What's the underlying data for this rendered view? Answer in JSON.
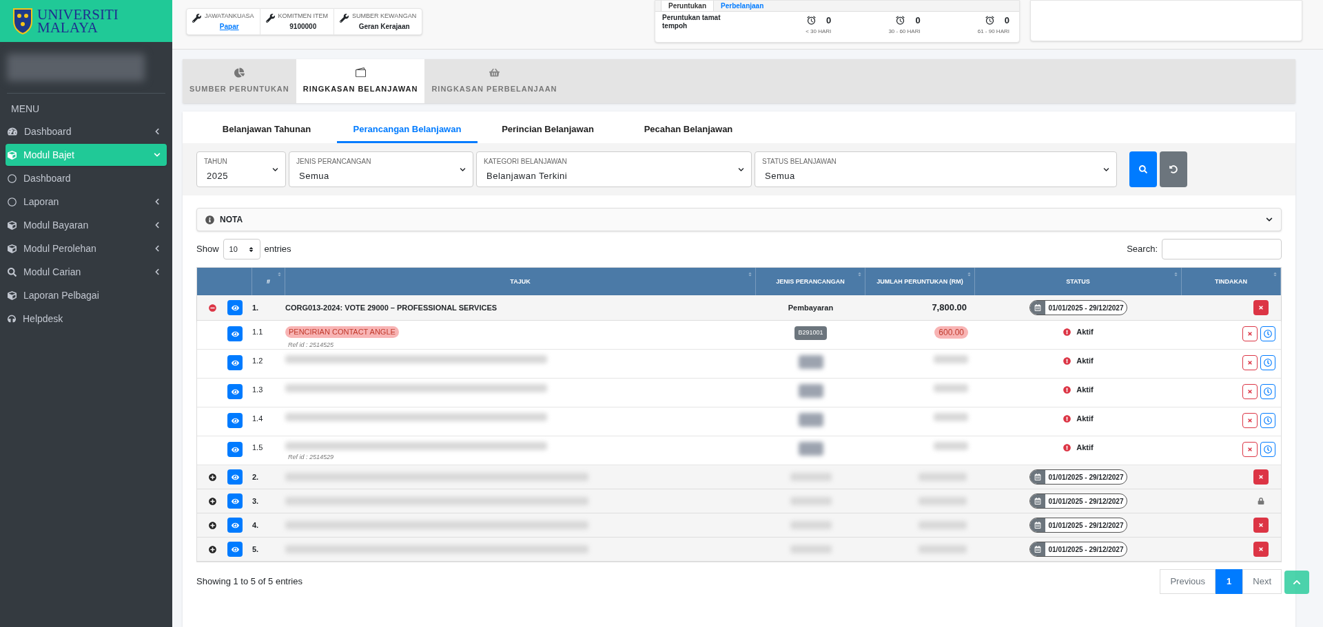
{
  "brand": {
    "line_1": "UNIVERSITI",
    "line_2": "MALAYA"
  },
  "sidebar": {
    "heading": "MENU",
    "items": [
      {
        "label": "Dashboard",
        "kind": "gauge",
        "selected": false,
        "submenu": true,
        "expanded": false
      },
      {
        "label": "Modul Bajet",
        "kind": "cube",
        "selected": true,
        "submenu": true,
        "expanded": true
      },
      {
        "label": "Dashboard",
        "kind": "circle",
        "selected": false,
        "submenu": false
      },
      {
        "label": "Laporan",
        "kind": "circle",
        "selected": false,
        "submenu": true,
        "expanded": false
      },
      {
        "label": "Modul Bayaran",
        "kind": "cube",
        "selected": false,
        "submenu": true,
        "expanded": false
      },
      {
        "label": "Modul Perolehan",
        "kind": "cube",
        "selected": false,
        "submenu": true,
        "expanded": false
      },
      {
        "label": "Modul Carian",
        "kind": "search",
        "selected": false,
        "submenu": true,
        "expanded": false
      },
      {
        "label": "Laporan Pelbagai",
        "kind": "cube",
        "selected": false,
        "submenu": false
      },
      {
        "label": "Helpdesk",
        "kind": "headset",
        "selected": false,
        "submenu": false
      }
    ]
  },
  "info_card": [
    {
      "label": "JAWATANKUASA",
      "value": "Papar",
      "kind": "link"
    },
    {
      "label": "KOMITMEN ITEM",
      "value": "9100000",
      "kind": "text"
    },
    {
      "label": "SUMBER KEWANGAN",
      "value": "Geran Kerajaan",
      "kind": "text"
    }
  ],
  "expiry_card": {
    "tabs": [
      {
        "label": "Peruntukan",
        "selected": true
      },
      {
        "label": "Perbelanjaan",
        "selected": false
      }
    ],
    "label": "Peruntukan tamat tempoh",
    "counters": [
      {
        "value": "0",
        "label": "< 30 HARI"
      },
      {
        "value": "0",
        "label": "30 - 60 HARI"
      },
      {
        "value": "0",
        "label": "61 - 90 HARI"
      }
    ]
  },
  "main_tabs": [
    {
      "label": "SUMBER PERUNTUKAN",
      "kind": "pie",
      "selected": false
    },
    {
      "label": "RINGKASAN BELANJAWAN",
      "kind": "wallet",
      "selected": true
    },
    {
      "label": "RINGKASAN PERBELANJAAN",
      "kind": "basket",
      "selected": false
    }
  ],
  "sub_tabs": [
    {
      "label": "Belanjawan Tahunan",
      "selected": false
    },
    {
      "label": "Perancangan Belanjawan",
      "selected": true
    },
    {
      "label": "Perincian Belanjawan",
      "selected": false
    },
    {
      "label": "Pecahan Belanjawan",
      "selected": false
    }
  ],
  "filters": [
    {
      "label": "TAHUN",
      "value": "2025"
    },
    {
      "label": "JENIS PERANCANGAN",
      "value": "Semua"
    },
    {
      "label": "KATEGORI BELANJAWAN",
      "value": "Belanjawan Terkini"
    },
    {
      "label": "STATUS BELANJAWAN",
      "value": "Semua"
    }
  ],
  "nota": {
    "label": "NOTA",
    "expanded": false
  },
  "length_control": {
    "before": "Show",
    "value": "10",
    "after": "entries"
  },
  "search": {
    "label": "Search:"
  },
  "table": {
    "columns": [
      "#",
      "TAJUK",
      "JENIS PERANCANGAN",
      "JUMLAH PERUNTUKAN (RM)",
      "STATUS",
      "TINDAKAN"
    ],
    "rows": [
      {
        "number": "1.",
        "title": "CORG013-2024: VOTE 29000 – PROFESSIONAL SERVICES",
        "jenis": "Pembayaran",
        "amount": "7,800.00",
        "period": "01/01/2025 - 29/12/2027",
        "kind": "delete",
        "expanded": true,
        "children": [
          {
            "number": "1.1",
            "title": "PENCIRIAN CONTACT ANGLE",
            "ref": "Ref id : 2514525",
            "code": "B291001",
            "amount": "600.00",
            "status": "Aktif",
            "highlighted": true
          },
          {
            "number": "1.2",
            "status": "Aktif",
            "redacted": true
          },
          {
            "number": "1.3",
            "status": "Aktif",
            "redacted": true
          },
          {
            "number": "1.4",
            "status": "Aktif",
            "redacted": true
          },
          {
            "number": "1.5",
            "ref": "Ref id : 2514529",
            "status": "Aktif",
            "redacted": true
          }
        ]
      },
      {
        "number": "2.",
        "period": "01/01/2025 - 29/12/2027",
        "kind": "delete",
        "redacted": true,
        "expanded": false
      },
      {
        "number": "3.",
        "period": "01/01/2025 - 29/12/2027",
        "kind": "lock",
        "redacted": true,
        "expanded": false
      },
      {
        "number": "4.",
        "period": "01/01/2025 - 29/12/2027",
        "kind": "delete",
        "redacted": true,
        "expanded": false
      },
      {
        "number": "5.",
        "period": "01/01/2025 - 29/12/2027",
        "kind": "delete",
        "redacted": true,
        "expanded": false
      }
    ]
  },
  "footer": {
    "summary": "Showing 1 to 5 of 5 entries",
    "pages": [
      {
        "label": "Previous",
        "kind": "nav",
        "selected": false
      },
      {
        "label": "1",
        "kind": "page",
        "selected": true
      },
      {
        "label": "Next",
        "kind": "nav",
        "selected": false
      }
    ]
  }
}
